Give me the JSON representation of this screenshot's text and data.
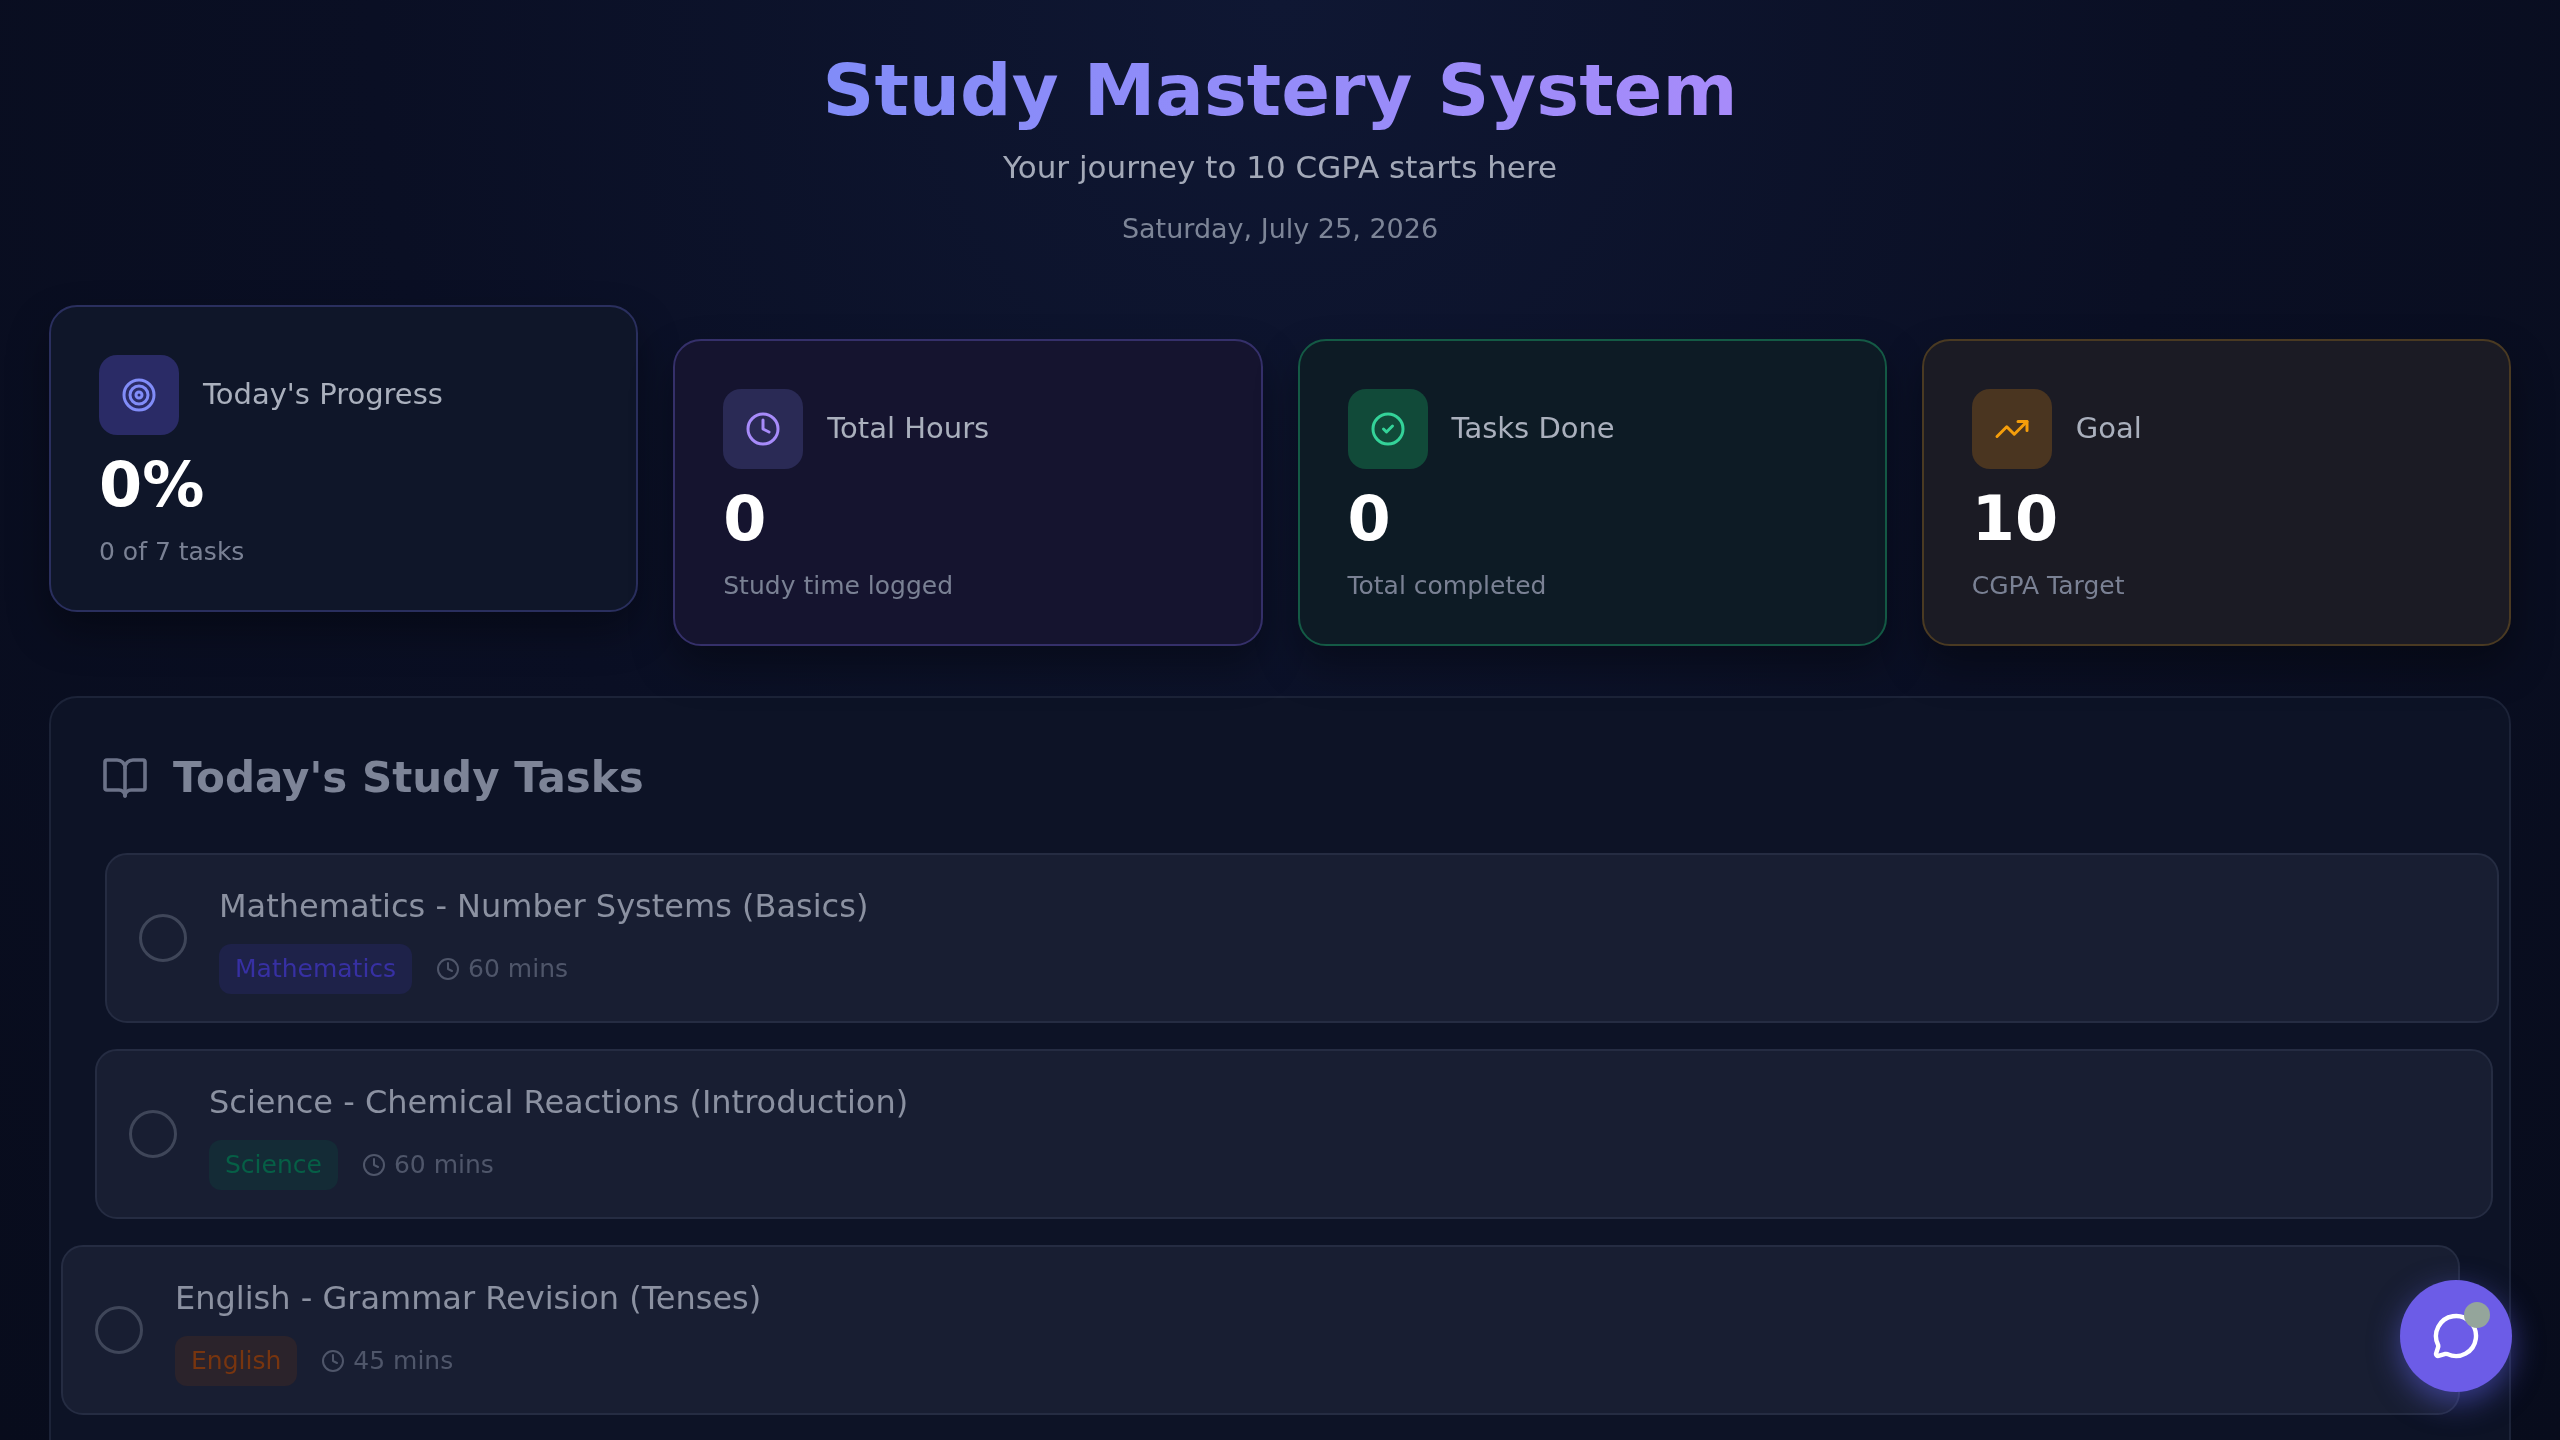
{
  "header": {
    "title": "Study Mastery System",
    "subtitle": "Your journey to 10 CGPA starts here",
    "date": "Saturday, July 25, 2026"
  },
  "stats": [
    {
      "kind": "progress",
      "label": "Today's Progress",
      "value": "0%",
      "caption": "0 of 7 tasks",
      "color": "#818cf8"
    },
    {
      "kind": "hours",
      "label": "Total Hours",
      "value": "0",
      "caption": "Study time logged",
      "color": "#a78bfa"
    },
    {
      "kind": "done",
      "label": "Tasks Done",
      "value": "0",
      "caption": "Total completed",
      "color": "#34d399"
    },
    {
      "kind": "goal",
      "label": "Goal",
      "value": "10",
      "caption": "CGPA Target",
      "color": "#f59e0b"
    }
  ],
  "tasks_panel": {
    "title": "Today's Study Tasks",
    "tasks": [
      {
        "title": "Mathematics - Number Systems (Basics)",
        "subject": "Mathematics",
        "duration": "60 mins",
        "checked": false,
        "color": "#3730a3"
      },
      {
        "title": "Science - Chemical Reactions (Introduction)",
        "subject": "Science",
        "duration": "60 mins",
        "checked": false,
        "color": "#065f46"
      },
      {
        "title": "English - Grammar Revision (Tenses)",
        "subject": "English",
        "duration": "45 mins",
        "checked": false,
        "color": "#78350f"
      }
    ]
  },
  "chat_button": {
    "unread": true
  }
}
